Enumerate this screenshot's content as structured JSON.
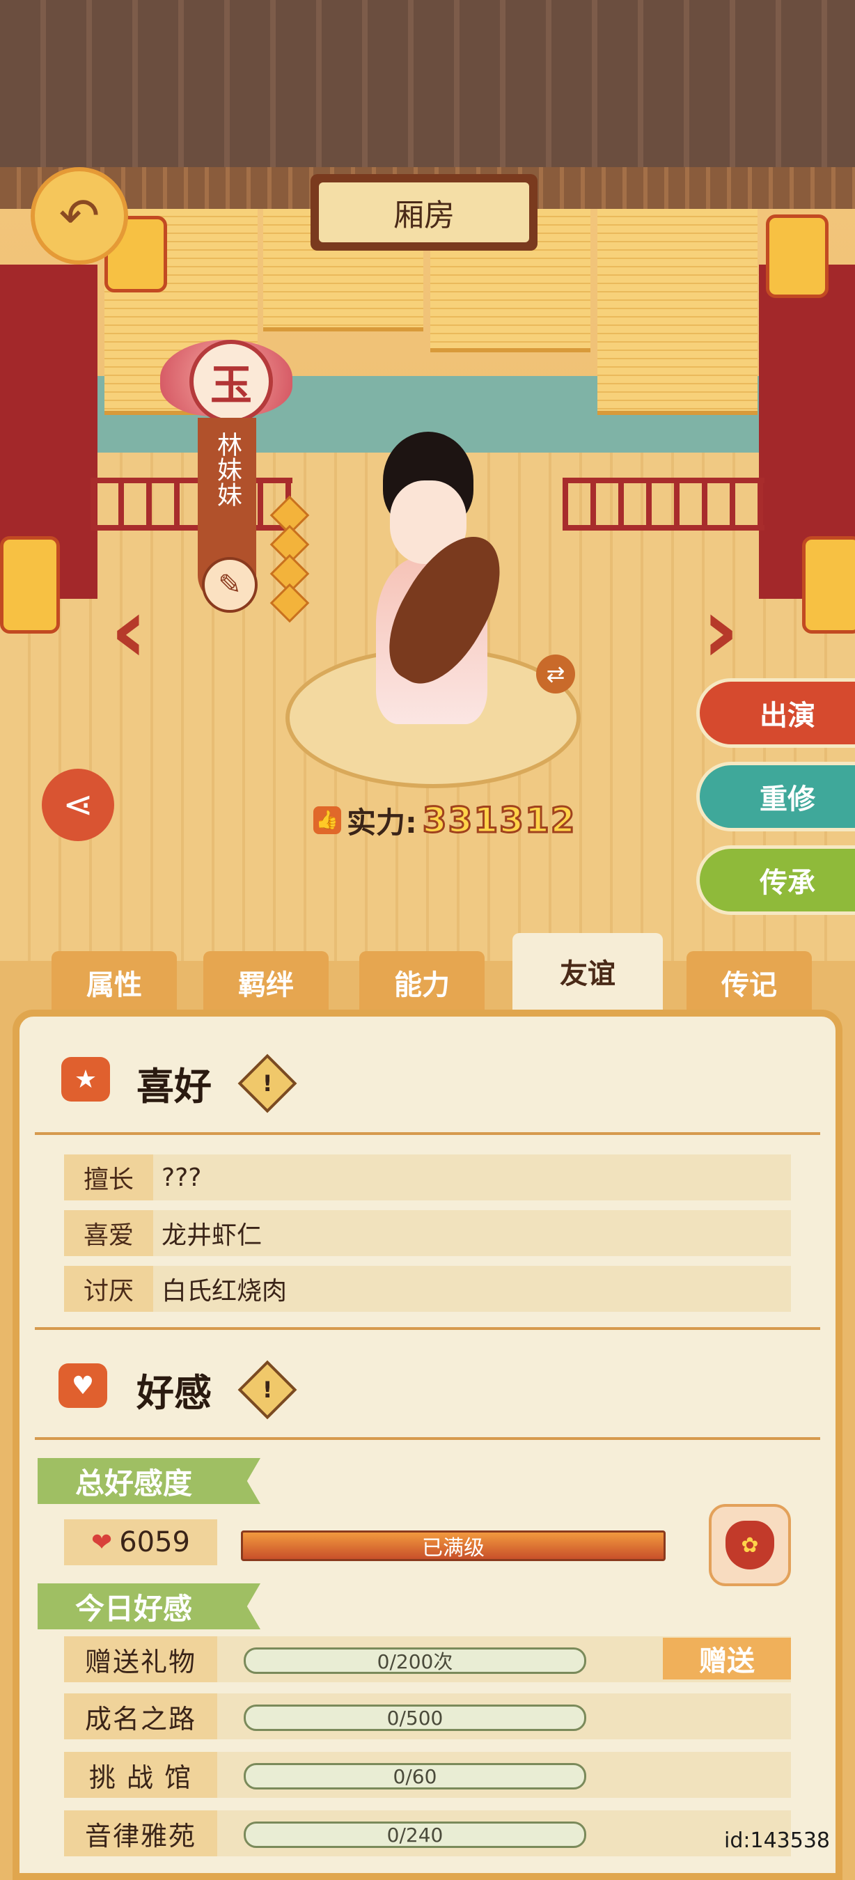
{
  "header": {
    "title": "厢房",
    "back_icon": "back-arrow-icon"
  },
  "character": {
    "rank": "玉",
    "name": "林妹妹",
    "power_label": "实力:",
    "power_value": "331312"
  },
  "actions": {
    "perform": "出演",
    "retrain": "重修",
    "inherit": "传承"
  },
  "tabs": [
    {
      "label": "属性",
      "active": false
    },
    {
      "label": "羁绊",
      "active": false
    },
    {
      "label": "能力",
      "active": false
    },
    {
      "label": "友谊",
      "active": true
    },
    {
      "label": "传记",
      "active": false
    }
  ],
  "preferences": {
    "title": "喜好",
    "rows": [
      {
        "key": "擅长",
        "value": "???"
      },
      {
        "key": "喜爱",
        "value": "龙井虾仁"
      },
      {
        "key": "讨厌",
        "value": "白氏红烧肉"
      }
    ]
  },
  "affection": {
    "title": "好感",
    "total_label": "总好感度",
    "total_value": "6059",
    "total_status": "已满级",
    "total_fill": 1.0,
    "today_label": "今日好感",
    "today_rows": [
      {
        "key": "赠送礼物",
        "progress": "0/200次"
      },
      {
        "key": "成名之路",
        "progress": "0/500"
      },
      {
        "key": "挑 战 馆",
        "progress": "0/60"
      },
      {
        "key": "音律雅苑",
        "progress": "0/240"
      }
    ],
    "gift_button": "赠送"
  },
  "footer": {
    "id": "id:143538"
  },
  "colors": {
    "accent_red": "#d95432",
    "teal": "#3fa89a",
    "green": "#8fba3a",
    "panel": "#f6eed8"
  }
}
